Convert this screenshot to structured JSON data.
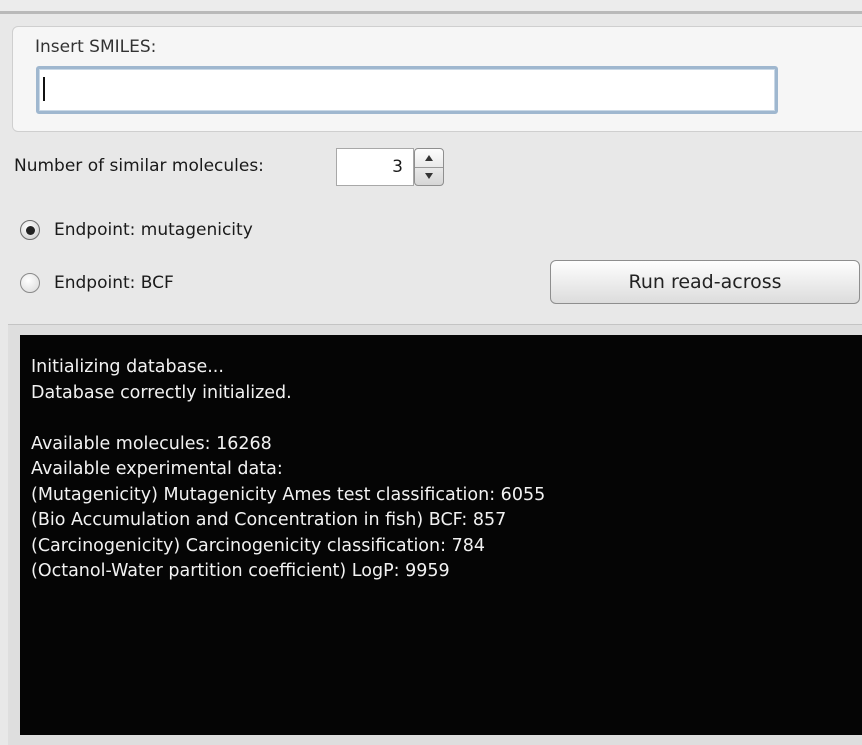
{
  "smiles": {
    "label": "Insert SMILES:",
    "value": "",
    "placeholder": ""
  },
  "similar": {
    "label": "Number of similar molecules:",
    "value": "3"
  },
  "endpoints": [
    {
      "label": "Endpoint: mutagenicity",
      "selected": true
    },
    {
      "label": "Endpoint: BCF",
      "selected": false
    }
  ],
  "run_button": {
    "label": "Run read-across"
  },
  "console": {
    "lines": [
      "Initializing database...",
      "Database correctly initialized.",
      "",
      "Available molecules: 16268",
      "Available experimental data:",
      "(Mutagenicity) Mutagenicity Ames test classification: 6055",
      "(Bio Accumulation and Concentration in fish) BCF: 857",
      "(Carcinogenicity) Carcinogenicity classification: 784",
      "(Octanol-Water partition coefficient) LogP: 9959"
    ]
  },
  "colors": {
    "background": "#e8e8e8",
    "console_background": "#050505",
    "console_text": "#f2f2f2",
    "input_focus_border": "#9fb7cf"
  },
  "icons": {
    "stepper_up": "triangle-up-icon",
    "stepper_down": "triangle-down-icon"
  }
}
